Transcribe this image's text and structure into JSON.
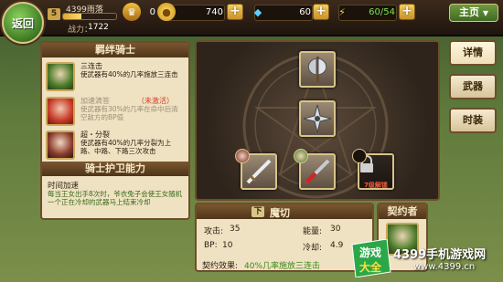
{
  "header": {
    "back_label": "返回",
    "player_level": "5",
    "player_name": "4399雨落",
    "exp_fraction": 0.35,
    "power_label": "战力：",
    "power_value": "1722",
    "resources": [
      {
        "icon": "rank-crown-icon",
        "value": "0"
      },
      {
        "icon": "gold-coin-icon",
        "value": "740"
      },
      {
        "icon": "diamond-icon",
        "value": "60"
      },
      {
        "icon": "energy-bolt-icon",
        "value": "60/54"
      }
    ],
    "home_label": "主页"
  },
  "knight_panel": {
    "title": "羁绊骑士",
    "skills": [
      {
        "name": "三连击",
        "desc": "使武器有40%的几率施放三连击",
        "active": true
      },
      {
        "name": "加速滴答",
        "tag": "（未激活）",
        "desc": "使武器有30%的几率在命中后清空敌方的BP值",
        "active": false
      },
      {
        "name": "超・分裂",
        "desc": "使武器有40%的几率分裂为上路、中路、下路三次攻击",
        "active": true
      }
    ]
  },
  "guard_panel": {
    "title": "骑士护卫能力",
    "ability_name": "时间加速",
    "ability_desc": "每当王女出手8次时，爷衣兔子会使王女随机一个正在冷却的武器马上结束冷却"
  },
  "arena": {
    "slots": [
      {
        "name": "axe-slot",
        "icon": "battle-axe-icon"
      },
      {
        "name": "shuriken-slot",
        "icon": "shuriken-icon"
      },
      {
        "name": "sword-slot-left",
        "icon": "sword-icon"
      },
      {
        "name": "sword-slot-center",
        "icon": "red-sword-icon"
      },
      {
        "name": "locked-slot",
        "icon": "lock-icon",
        "lock_text": "7级解锁"
      }
    ]
  },
  "weapon_info": {
    "level_badge": "下",
    "name": "魔切",
    "attack_label": "攻击:",
    "attack": "35",
    "energy_label": "能量:",
    "energy": "30",
    "bp_label": "BP:",
    "bp": "10",
    "cooldown_label": "冷却:",
    "cooldown": "4.9",
    "effect_label": "契约效果:",
    "effect_value": "40%几率施放三连击"
  },
  "contract": {
    "title": "契约者"
  },
  "side_tabs": [
    {
      "label": "详情",
      "active": true
    },
    {
      "label": "武器",
      "active": false
    },
    {
      "label": "时装",
      "active": false
    }
  ],
  "watermark": {
    "logo_line1": "游戏",
    "logo_line2": "大全",
    "site_name": "4399手机游戏网",
    "site_url": "www.4399.cn"
  }
}
